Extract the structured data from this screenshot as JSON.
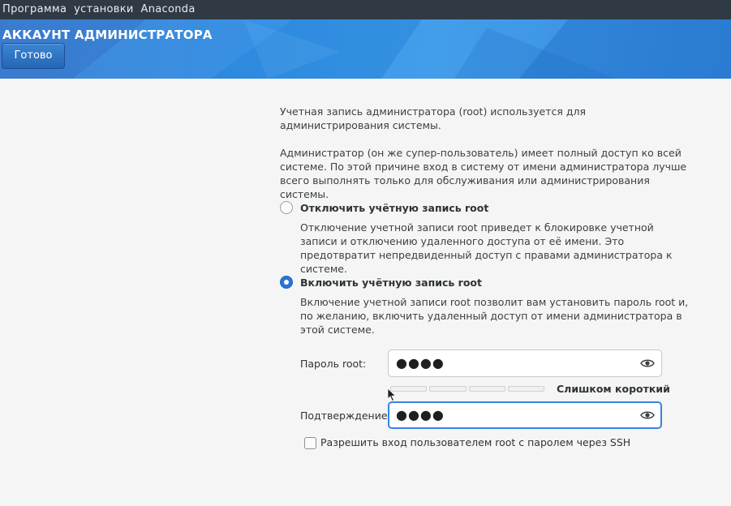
{
  "topbar": {
    "title": "Программа  установки  Anaconda"
  },
  "header": {
    "title": "АККАУНТ АДМИНИСТРАТОРА",
    "done_label": "Готово"
  },
  "intro": {
    "line1": "Учетная запись администратора (root) используется для администрирования системы.",
    "line2": "Администратор (он же супер-пользователь) имеет полный доступ ко всей системе. По этой причине вход в систему от имени администратора лучше всего выполнять только для обслуживания или администрирования системы."
  },
  "options": {
    "disable": {
      "title": "Отключить учётную запись root",
      "description": "Отключение учетной записи root приведет к блокировке учетной записи и отключению удаленного доступа от её имени. Это предотвратит непредвиденный доступ с правами администратора к системе.",
      "selected": false
    },
    "enable": {
      "title": "Включить учётную запись root",
      "description": "Включение учетной записи root позволит вам установить пароль root и, по желанию, включить удаленный доступ от имени администратора в этой системе.",
      "selected": true
    }
  },
  "password": {
    "label": "Пароль root:",
    "value": "●●●●",
    "icon": "eye-icon",
    "strength_segments": 4,
    "strength_filled": 0,
    "strength_text": "Слишком короткий"
  },
  "confirm": {
    "label": "Подтверждение:",
    "value": "●●●●",
    "icon": "eye-icon"
  },
  "ssh": {
    "label": "Разрешить вход пользователем root с паролем через SSH",
    "checked": false
  },
  "colors": {
    "accent": "#3584e4",
    "header": "#2f8fe3",
    "topbar": "#2f3a45"
  }
}
